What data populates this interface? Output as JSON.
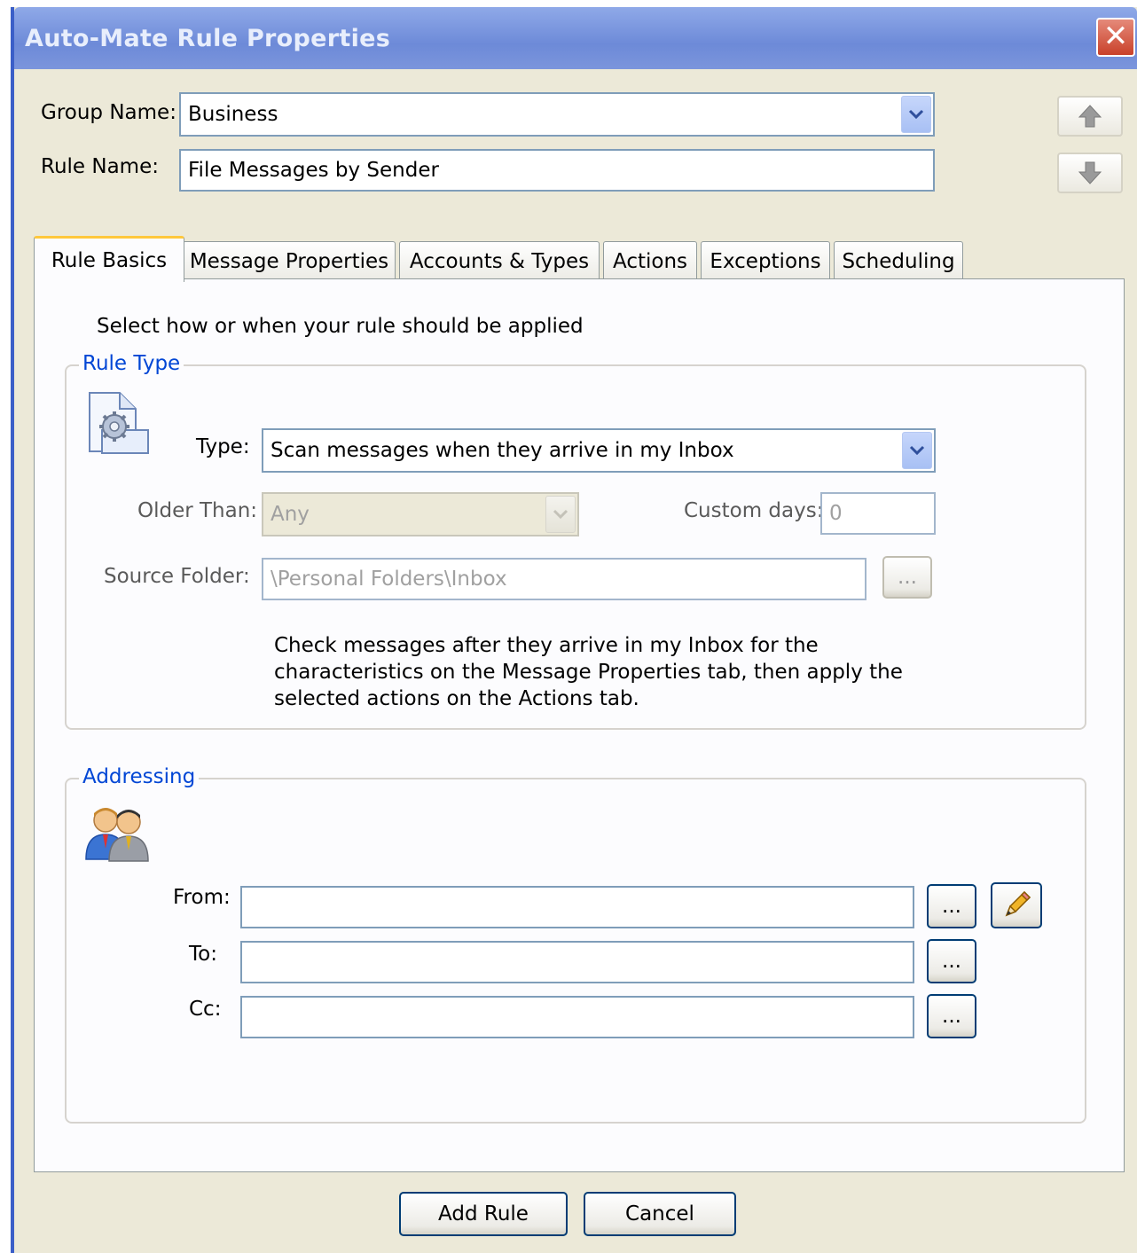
{
  "window": {
    "title": "Auto-Mate Rule Properties",
    "close_icon": "close-icon"
  },
  "header": {
    "group_name_label": "Group Name:",
    "group_name_value": "Business",
    "rule_name_label": "Rule Name:",
    "rule_name_value": "File Messages by Sender"
  },
  "tabs": [
    {
      "label": "Rule Basics",
      "active": true
    },
    {
      "label": "Message Properties"
    },
    {
      "label": "Accounts & Types"
    },
    {
      "label": "Actions"
    },
    {
      "label": "Exceptions"
    },
    {
      "label": "Scheduling"
    }
  ],
  "rule_basics": {
    "intro": "Select how or when your rule should be applied",
    "rule_type_group": "Rule Type",
    "type_label": "Type:",
    "type_value": "Scan messages when they arrive in my Inbox",
    "older_than_label": "Older Than:",
    "older_than_value": "Any",
    "custom_days_label": "Custom days:",
    "custom_days_value": "0",
    "source_folder_label": "Source Folder:",
    "source_folder_value": "\\Personal Folders\\Inbox",
    "browse_label": "...",
    "description_lines": [
      "Check messages after they arrive in my Inbox for the",
      "characteristics on the Message Properties tab, then apply the",
      "selected actions on the Actions tab."
    ]
  },
  "addressing": {
    "group": "Addressing",
    "from_label": "From:",
    "from_value": "",
    "to_label": "To:",
    "to_value": "",
    "cc_label": "Cc:",
    "cc_value": "",
    "browse_label": "..."
  },
  "footer": {
    "add_rule_label": "Add Rule",
    "cancel_label": "Cancel"
  }
}
